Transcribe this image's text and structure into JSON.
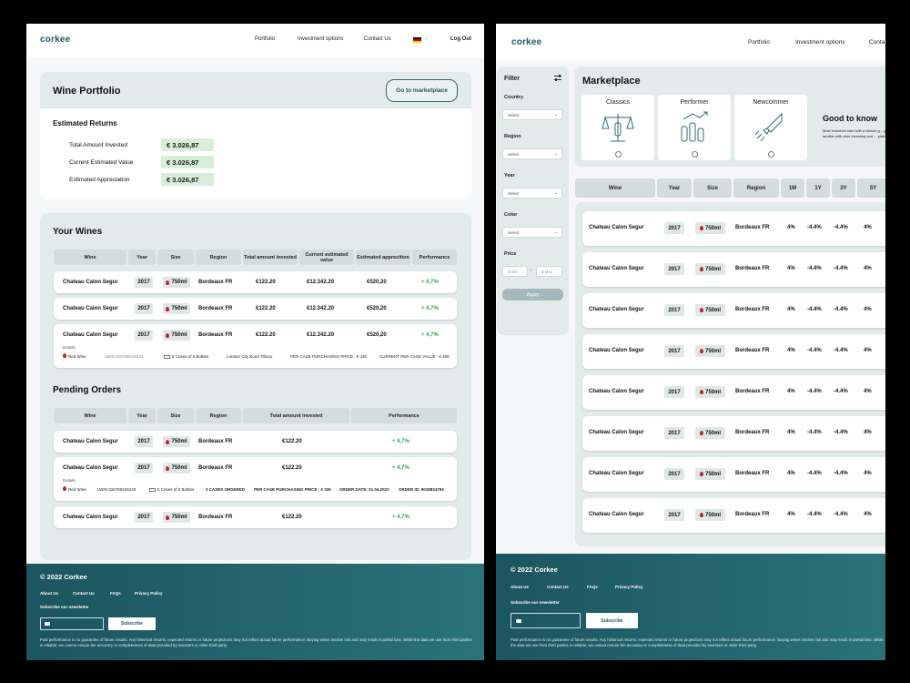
{
  "brand": {
    "logo": "corkee",
    "accent": "#1f5b63",
    "positive_color": "#2ea44f"
  },
  "nav": {
    "portfolio": "Portfolio",
    "investment": "Investment options",
    "contact": "Contact Us",
    "contact_cut": "Conta",
    "logout": "Log Out",
    "flag_icon": "german-flag-icon"
  },
  "portfolio": {
    "title": "Wine Portfolio",
    "marketplace_button": "Go to marketplace",
    "returns_title": "Estimated Returns",
    "returns": [
      {
        "label": "Total Amount Invested",
        "value": "€ 3.026,87"
      },
      {
        "label": "Current Estimated Value",
        "value": "€ 3.026,87"
      },
      {
        "label": "Estimated Appreciation",
        "value": "€ 3.026,87"
      }
    ]
  },
  "your_wines": {
    "title": "Your Wines",
    "headers": [
      "Wine",
      "Year",
      "Size",
      "Region",
      "Total amount invested",
      "Current estimated value",
      "Estimated apprecition",
      "Performance"
    ],
    "rows": [
      {
        "wine": "Chateau Calon Segur",
        "year": "2017",
        "size": "750ml",
        "region": "Bordeaux FR",
        "invested": "€122.20",
        "value": "€12.342.20",
        "appreciation": "€520,20",
        "performance": "+ 4,7%"
      },
      {
        "wine": "Chateau Calon Segur",
        "year": "2017",
        "size": "750ml",
        "region": "Bordeaux FR",
        "invested": "€122.20",
        "value": "€12.342.20",
        "appreciation": "€520,20",
        "performance": "+ 4,7%"
      },
      {
        "wine": "Chateau Calon Segur",
        "year": "2017",
        "size": "750ml",
        "region": "Bordeaux FR",
        "invested": "€122.20",
        "value": "€12.342.20",
        "appreciation": "€520,20",
        "performance": "+ 4,7%"
      }
    ],
    "details": {
      "label": "Details",
      "type": "Red Wine",
      "lwin": "LWIN:326789226233",
      "cases": "5 Cases of 6 Bottles",
      "location": "London City Bond Tilbury",
      "case_price": "PER CASE PURCHASING PRICE : € 330",
      "current_price": "CURRENT PER CASE VALUE : € 490"
    }
  },
  "pending": {
    "title": "Pending Orders",
    "headers": [
      "Wine",
      "Year",
      "Size",
      "Region",
      "Total amount invested",
      "Performance"
    ],
    "rows": [
      {
        "wine": "Chateau Calon Segur",
        "year": "2017",
        "size": "750ml",
        "region": "Bordeaux FR",
        "invested": "€122.20",
        "performance": "+ 4,7%"
      },
      {
        "wine": "Chateau Calon Segur",
        "year": "2017",
        "size": "750ml",
        "region": "Bordeaux FR",
        "invested": "€122.20",
        "performance": "+ 4,7%"
      },
      {
        "wine": "Chateau Calon Segur",
        "year": "2017",
        "size": "750ml",
        "region": "Bordeaux FR",
        "invested": "€122.20",
        "performance": "+ 4,7%"
      }
    ],
    "details": {
      "label": "Details",
      "type": "Red Wine",
      "lwin": "LWIN:326789226233",
      "cases": "5 Cases of 6 Bottles",
      "ordered": "3 CASES ORDERED",
      "case_price": "PER CASE PURCHASING PRICE : € 330",
      "order_date": "ORDER DATE: 01.04.2022",
      "order_id": "ORDER ID: 9018834793"
    }
  },
  "footer": {
    "copyright": "© 2022 Corkee",
    "links": [
      "About Us",
      "Contact Us",
      "FAQs",
      "Privacy Policy"
    ],
    "subscribe_label": "Subscribe our newsletter",
    "subscribe_button": "Subscribe",
    "mail_icon": "mail-icon",
    "disclaimer_left": "Past performance is no guarantee of future results. Any historical returns, expected returns or future projections may not reflect actual future performance. Buying wines involve risk and may result in partial loss. While the data we use from third parties is reliable, we cannot ensure the accuracy or completeness of data provided by investors or other third party.",
    "disclaimer_right": "Past performance is no guarantee of future results. Any historical returns, expected returns or future projections may not reflect actual future performance. Buying wines involve risk and may result in partial loss. While the data we use from third parties is reliable, we cannot ensure the accuracy or completeness of data provided by investors or other third party."
  },
  "filter": {
    "title": "Filter",
    "groups": [
      {
        "label": "Country",
        "placeholder": "Select"
      },
      {
        "label": "Region",
        "placeholder": "Select"
      },
      {
        "label": "Year",
        "placeholder": "Select"
      },
      {
        "label": "Color",
        "placeholder": "Select"
      }
    ],
    "price_label": "Price",
    "min": "$ Min",
    "max": "$ Max",
    "apply": "Apply"
  },
  "marketplace": {
    "title": "Marketplace",
    "categories": [
      {
        "name": "Classics",
        "icon": "scale-bottles-icon"
      },
      {
        "name": "Performer",
        "icon": "bottles-growth-icon"
      },
      {
        "name": "Newcommer",
        "icon": "rocket-bottle-icon"
      }
    ],
    "good_title": "Good to know",
    "good_text": "Most investors start with a classic g... get familiar with wine investing and ... platform.",
    "headers": [
      "Wine",
      "Year",
      "Size",
      "Region",
      "1M",
      "1Y",
      "2Y",
      "5Y"
    ],
    "rows": [
      {
        "wine": "Chateau Calon Segur",
        "year": "2017",
        "size": "750ml",
        "region": "Bordeaux FR",
        "m1": "4%",
        "y1": "-4.4%",
        "y2": "-4.4%",
        "y5": "4%"
      },
      {
        "wine": "Chateau Calon Segur",
        "year": "2017",
        "size": "750ml",
        "region": "Bordeaux FR",
        "m1": "4%",
        "y1": "-4.4%",
        "y2": "-4.4%",
        "y5": "4%"
      },
      {
        "wine": "Chateau Calon Segur",
        "year": "2017",
        "size": "750ml",
        "region": "Bordeaux FR",
        "m1": "4%",
        "y1": "-4.4%",
        "y2": "-4.4%",
        "y5": "4%"
      },
      {
        "wine": "Chateau Calon Segur",
        "year": "2017",
        "size": "750ml",
        "region": "Bordeaux FR",
        "m1": "4%",
        "y1": "-4.4%",
        "y2": "-4.4%",
        "y5": "4%"
      },
      {
        "wine": "Chateau Calon Segur",
        "year": "2017",
        "size": "750ml",
        "region": "Bordeaux FR",
        "m1": "4%",
        "y1": "-4.4%",
        "y2": "-4.4%",
        "y5": "4%"
      },
      {
        "wine": "Chateau Calon Segur",
        "year": "2017",
        "size": "750ml",
        "region": "Bordeaux FR",
        "m1": "4%",
        "y1": "-4.4%",
        "y2": "-4.4%",
        "y5": "4%"
      },
      {
        "wine": "Chateau Calon Segur",
        "year": "2017",
        "size": "750ml",
        "region": "Bordeaux FR",
        "m1": "4%",
        "y1": "-4.4%",
        "y2": "-4.4%",
        "y5": "4%"
      },
      {
        "wine": "Chateau Calon Segur",
        "year": "2017",
        "size": "750ml",
        "region": "Bordeaux FR",
        "m1": "4%",
        "y1": "-4.4%",
        "y2": "-4.4%",
        "y5": "4%"
      }
    ]
  }
}
